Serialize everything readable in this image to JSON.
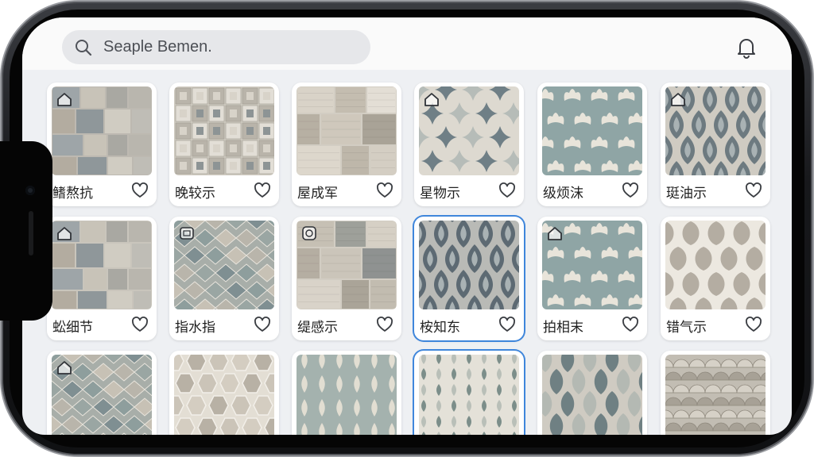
{
  "search": {
    "placeholder": "Seaple Bemen."
  },
  "header": {
    "notification_icon": "bell-icon"
  },
  "colors": {
    "accent": "#3f86db",
    "card_bg": "#ffffff",
    "screen_bg": "#eef0f3"
  },
  "tiles": [
    {
      "label": "鳍熬抗",
      "pattern": "squares",
      "badge": "home-icon",
      "selected": false
    },
    {
      "label": "晚较示",
      "pattern": "geo-squares",
      "badge": "",
      "selected": false
    },
    {
      "label": "屋成军",
      "pattern": "stone",
      "badge": "",
      "selected": false
    },
    {
      "label": "星物示",
      "pattern": "star-quatrefoil",
      "badge": "home-icon",
      "selected": false
    },
    {
      "label": "级烦沫",
      "pattern": "teal-fleur",
      "badge": "",
      "selected": false
    },
    {
      "label": "珽油示",
      "pattern": "ikat",
      "badge": "home-icon",
      "selected": false
    },
    {
      "label": "蚣细节",
      "pattern": "squares-light",
      "badge": "home-icon",
      "selected": false
    },
    {
      "label": "指水指",
      "pattern": "diamonds",
      "badge": "image-icon",
      "selected": false
    },
    {
      "label": "缇感示",
      "pattern": "stone-mosaic",
      "badge": "gear-icon",
      "selected": false
    },
    {
      "label": "桉知东",
      "pattern": "ikat-blue",
      "badge": "",
      "selected": true
    },
    {
      "label": "拍相末",
      "pattern": "teal-fleur-2",
      "badge": "home-icon",
      "selected": false
    },
    {
      "label": "错气示",
      "pattern": "ogee",
      "badge": "",
      "selected": false
    },
    {
      "label": "",
      "pattern": "diamond-squares",
      "badge": "home-icon",
      "selected": false
    },
    {
      "label": "",
      "pattern": "marble-hex",
      "badge": "",
      "selected": false
    },
    {
      "label": "",
      "pattern": "teal-stripes",
      "badge": "",
      "selected": false
    },
    {
      "label": "",
      "pattern": "leaf-stripes",
      "badge": "",
      "selected": true
    },
    {
      "label": "",
      "pattern": "hexagons",
      "badge": "",
      "selected": false
    },
    {
      "label": "",
      "pattern": "scales",
      "badge": "",
      "selected": false
    }
  ]
}
